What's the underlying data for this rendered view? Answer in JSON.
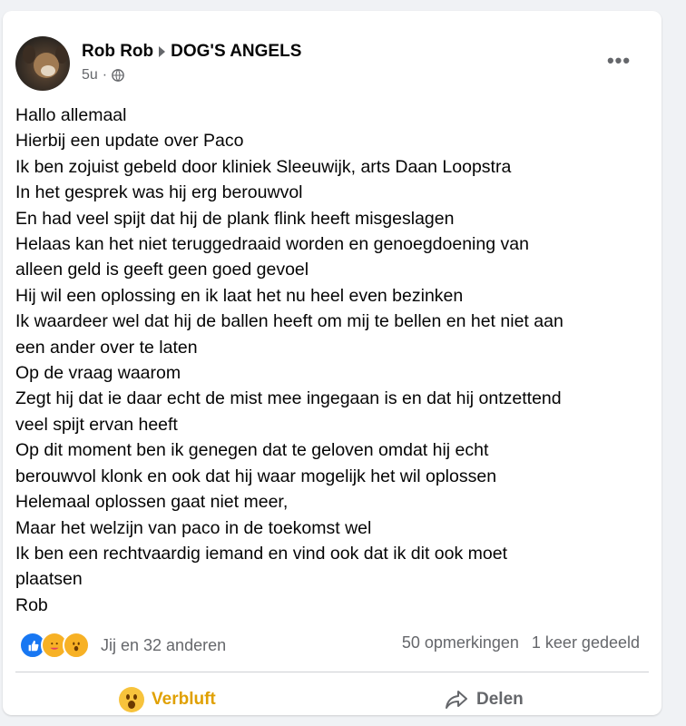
{
  "post": {
    "author": "Rob Rob",
    "group": "DOG'S ANGELS",
    "time": "5u",
    "privacy_icon": "globe-icon",
    "more_icon": "more-options-icon",
    "lines": [
      "Hallo allemaal",
      "Hierbij een update over Paco",
      "Ik ben zojuist gebeld door kliniek Sleeuwijk, arts Daan Loopstra",
      "In het gesprek was hij erg berouwvol",
      "En had veel spijt dat hij de plank flink heeft misgeslagen",
      "Helaas kan het niet teruggedraaid worden en genoegdoening van",
      "alleen geld is geeft geen goed gevoel",
      "Hij wil een oplossing en ik laat het nu heel even bezinken",
      "Ik waardeer wel dat hij de ballen heeft om mij te bellen en het niet aan",
      "een ander over te laten",
      "Op de vraag waarom",
      "Zegt hij dat ie daar echt de mist mee ingegaan is en dat hij ontzettend",
      "veel spijt ervan heeft",
      "Op dit moment ben ik genegen dat te geloven omdat hij echt",
      "berouwvol klonk en ook dat hij waar mogelijk het wil oplossen",
      "Helemaal oplossen gaat niet meer,",
      "Maar het welzijn van paco in de toekomst wel",
      "Ik ben een rechtvaardig iemand en vind ook dat ik dit ook moet",
      "plaatsen",
      "Rob"
    ]
  },
  "reactions": {
    "icons": [
      "like-icon",
      "care-icon",
      "wow-icon"
    ],
    "summary": "Jij en 32 anderen",
    "comments": "50 opmerkingen",
    "shares": "1 keer gedeeld"
  },
  "actions": {
    "reaction_label": "Verbluft",
    "reaction_icon": "wow-icon",
    "share_label": "Delen",
    "share_icon": "share-arrow-icon"
  },
  "colors": {
    "reaction_active": "#e0a000",
    "muted_text": "#65676b",
    "like_blue": "#1877f2"
  }
}
